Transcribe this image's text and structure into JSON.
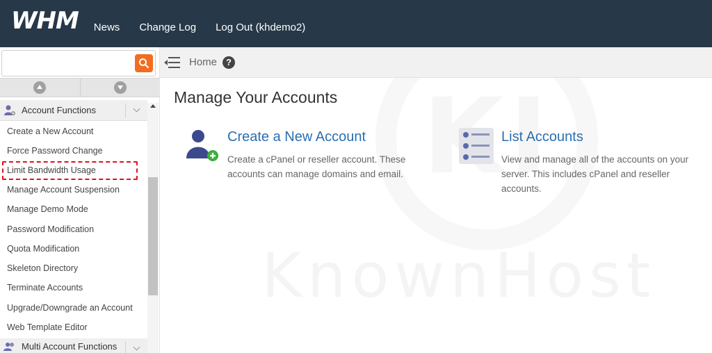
{
  "header": {
    "logo": "WHM",
    "nav": [
      "News",
      "Change Log",
      "Log Out (khdemo2)"
    ]
  },
  "sidebar": {
    "search": {
      "value": "",
      "placeholder": ""
    },
    "category": "Account Functions",
    "items": [
      "Create a New Account",
      "Force Password Change",
      "Limit Bandwidth Usage",
      "Manage Account Suspension",
      "Manage Demo Mode",
      "Password Modification",
      "Quota Modification",
      "Skeleton Directory",
      "Terminate Accounts",
      "Upgrade/Downgrade an Account",
      "Web Template Editor"
    ],
    "highlighted_item": "Limit Bandwidth Usage",
    "next_category": "Multi Account Functions"
  },
  "breadcrumb": {
    "home": "Home",
    "help": "?"
  },
  "main": {
    "title": "Manage Your Accounts",
    "cards": [
      {
        "title": "Create a New Account",
        "desc_line1": "Create a cPanel or reseller account. These",
        "desc_line2": "accounts can manage domains and email."
      },
      {
        "title": "List Accounts",
        "desc_line1": "View and manage all of the accounts on your",
        "desc_line2": "server. This includes cPanel and reseller",
        "desc_line3": "accounts."
      }
    ]
  },
  "watermark": {
    "text": "KnownHost",
    "monogram": "KI"
  },
  "colors": {
    "topbar": "#273848",
    "accent": "#f26d21",
    "link": "#2a6fb0",
    "highlight": "#e0101a"
  }
}
